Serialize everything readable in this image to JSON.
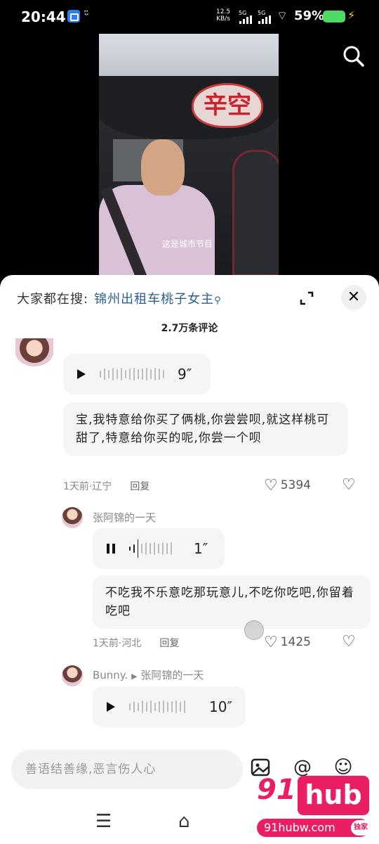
{
  "status_bar": {
    "time": "20:44",
    "speed_value": "12.5",
    "speed_unit": "KB/s",
    "signal1": "5G",
    "signal2": "5G",
    "battery": "59%"
  },
  "video": {
    "sign_text": "辛空",
    "subtitle": "这是城市节目"
  },
  "sheet": {
    "hot_search_prefix": "大家都在搜:",
    "hot_search_keyword": "锦州出租车桃子女主",
    "comment_count": "2.7万条评论"
  },
  "comments": [
    {
      "voice_duration": "9″",
      "text": "宝,我特意给你买了俩桃,你尝尝呗,就这样桃可甜了,特意给你买的呢,你尝一个呗",
      "meta": "1天前·辽宁",
      "reply": "回复",
      "likes": "5394"
    },
    {
      "username": "张阿锦的一天",
      "voice_duration": "1″",
      "text": "不吃我不乐意吃那玩意儿,不吃你吃吧,你留着吃吧",
      "meta": "1天前·河北",
      "reply": "回复",
      "likes": "1425"
    },
    {
      "username": "Bunny.",
      "reply_to": "张阿锦的一天",
      "voice_duration": "10″"
    }
  ],
  "input": {
    "placeholder": "善语结善缘,恶言伤人心"
  },
  "watermark": {
    "num": "91",
    "brand": "hub",
    "site": "91hubw.com",
    "badge": "独家"
  }
}
